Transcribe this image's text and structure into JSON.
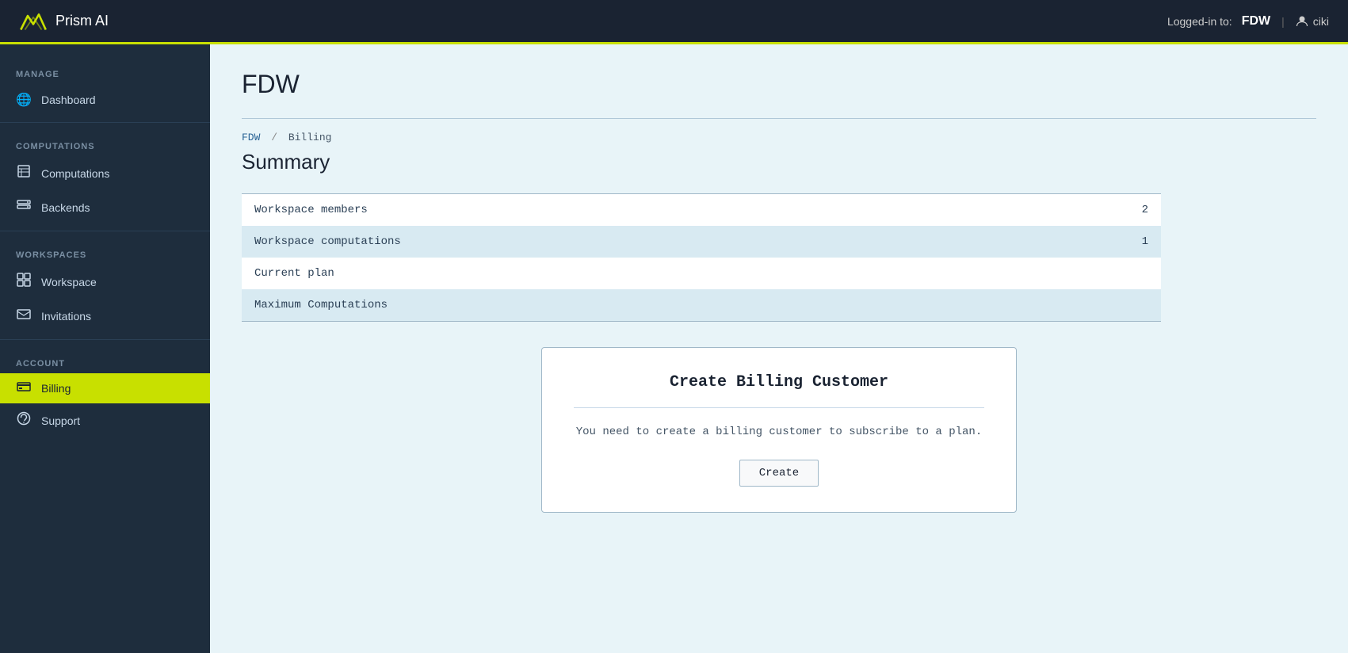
{
  "app": {
    "name": "Prism AI"
  },
  "header": {
    "logged_in_label": "Logged-in to:",
    "org": "FDW",
    "divider": "|",
    "user": "ciki"
  },
  "sidebar": {
    "sections": [
      {
        "label": "MANAGE",
        "items": [
          {
            "id": "dashboard",
            "label": "Dashboard",
            "icon": "🌐",
            "active": false
          }
        ]
      },
      {
        "label": "COMPUTATIONS",
        "items": [
          {
            "id": "computations",
            "label": "Computations",
            "icon": "📋",
            "active": false
          },
          {
            "id": "backends",
            "label": "Backends",
            "icon": "📊",
            "active": false
          }
        ]
      },
      {
        "label": "WORKSPACES",
        "items": [
          {
            "id": "workspace",
            "label": "Workspace",
            "icon": "⊞",
            "active": false
          },
          {
            "id": "invitations",
            "label": "Invitations",
            "icon": "👤",
            "active": false
          }
        ]
      },
      {
        "label": "ACCOUNT",
        "items": [
          {
            "id": "billing",
            "label": "Billing",
            "icon": "💳",
            "active": true
          },
          {
            "id": "support",
            "label": "Support",
            "icon": "🎧",
            "active": false
          }
        ]
      }
    ]
  },
  "main": {
    "page_title": "FDW",
    "breadcrumb": {
      "parts": [
        "FDW",
        "Billing"
      ],
      "separator": "/"
    },
    "section_title": "Summary",
    "table": {
      "rows": [
        {
          "label": "Workspace members",
          "value": "2"
        },
        {
          "label": "Workspace computations",
          "value": "1"
        },
        {
          "label": "Current plan",
          "value": ""
        },
        {
          "label": "Maximum Computations",
          "value": ""
        }
      ]
    },
    "billing_card": {
      "title": "Create Billing Customer",
      "description": "You need to create a billing customer to subscribe to a plan.",
      "button_label": "Create"
    }
  }
}
